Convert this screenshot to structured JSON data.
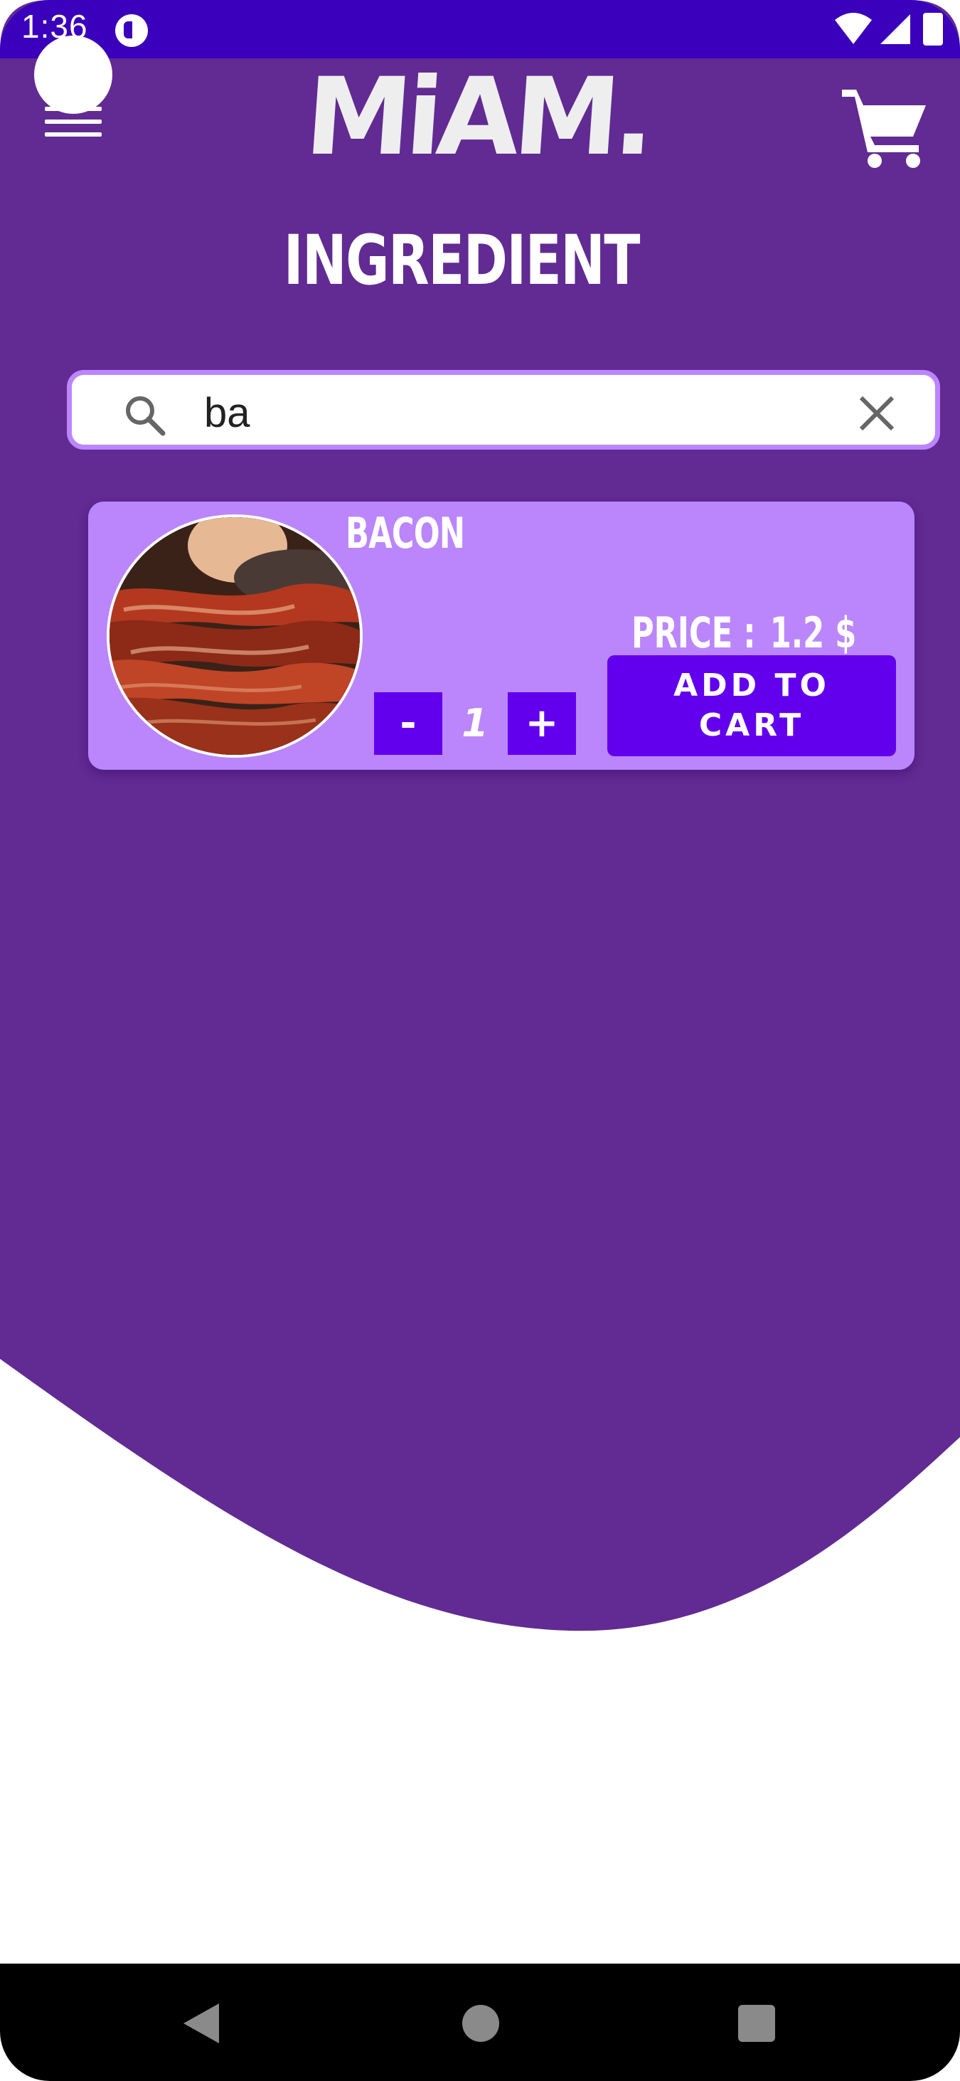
{
  "status_bar": {
    "time": "1:36",
    "icons": [
      "notification-icon",
      "wifi-icon",
      "signal-icon",
      "battery-icon"
    ]
  },
  "header": {
    "menu_icon": "hamburger-menu-icon",
    "logo_text": "MiAM.",
    "cart_icon": "shopping-cart-icon"
  },
  "page": {
    "title": "INGREDIENT"
  },
  "search": {
    "value": "ba",
    "placeholder": "",
    "search_icon": "search-icon",
    "clear_icon": "close-icon"
  },
  "results": [
    {
      "name": "BACON",
      "price_label": "PRICE :",
      "price_value": "1.2 $",
      "quantity": "1",
      "minus_label": "-",
      "plus_label": "+",
      "add_to_cart_label": "ADD TO CART",
      "image": "bacon-photo"
    }
  ],
  "nav_bar": {
    "back": "back-icon",
    "home": "home-icon",
    "recents": "recents-icon"
  },
  "colors": {
    "primary_purple": "#622a93",
    "status_bar": "#3a00bc",
    "card": "#bb86fc",
    "accent_button": "#6200ee",
    "search_border": "#bb86fc"
  }
}
